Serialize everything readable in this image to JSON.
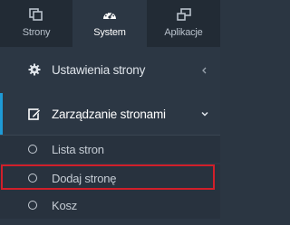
{
  "tabs": [
    {
      "label": "Strony",
      "icon": "pages-icon",
      "active": false
    },
    {
      "label": "System",
      "icon": "dashboard-icon",
      "active": true
    },
    {
      "label": "Aplikacje",
      "icon": "apps-icon",
      "active": false
    }
  ],
  "menu": {
    "settings": {
      "label": "Ustawienia strony",
      "icon": "gear-icon",
      "chevron": "chevron-left-icon"
    },
    "management": {
      "label": "Zarządzanie stronami",
      "icon": "edit-icon",
      "chevron": "chevron-down-icon"
    }
  },
  "submenu": [
    {
      "label": "Lista stron"
    },
    {
      "label": "Dodaj stronę"
    },
    {
      "label": "Kosz"
    }
  ],
  "colors": {
    "sidebar_bg": "#2c3744",
    "tabbar_bg": "#222b35",
    "accent": "#1e9ad6",
    "highlight": "#d11f2a"
  }
}
